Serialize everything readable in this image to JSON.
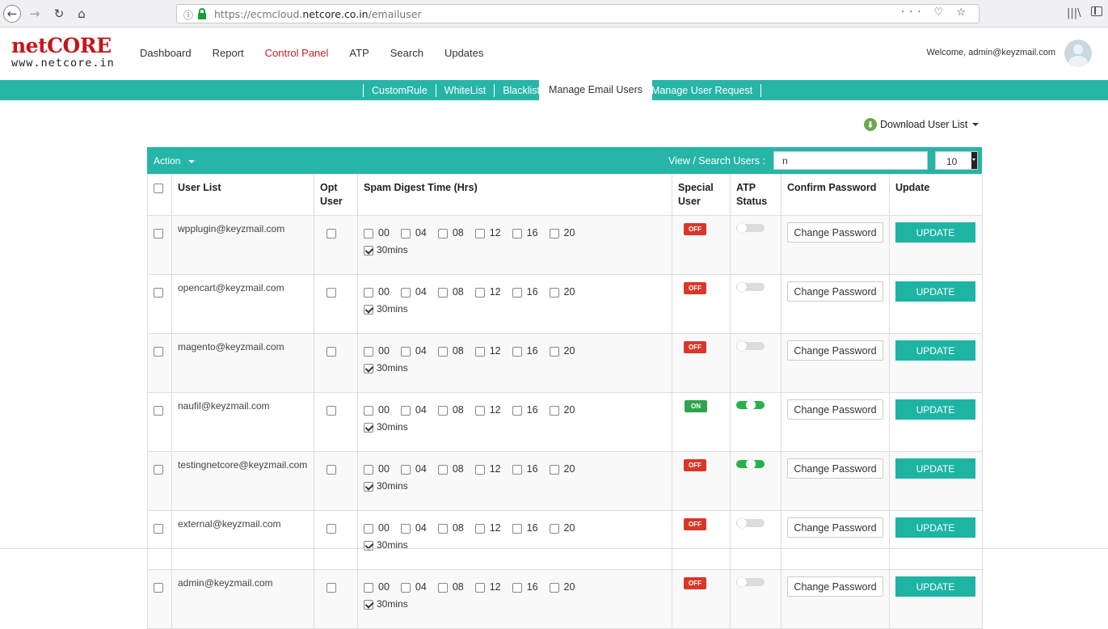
{
  "browser": {
    "url_prefix": "https://ecmcloud.",
    "url_domain": "netcore.co.in",
    "url_path": "/emailuser",
    "actions": "··· ♡ ☆"
  },
  "logo": {
    "top": "netC",
    "o": "O",
    "rest": "RE",
    "bottom": "www.netcore.in"
  },
  "nav": {
    "items": [
      "Dashboard",
      "Report",
      "Control Panel",
      "ATP",
      "Search",
      "Updates"
    ],
    "active": "Control Panel"
  },
  "welcome": "Welcome, admin@keyzmail.com",
  "subnav": [
    "CustomRule",
    "WhiteList",
    "Blacklist",
    "Manage Email Users",
    "Manage User Request"
  ],
  "download_label": "Download User List",
  "toolbar": {
    "action_label": "Action",
    "search_label": "View / Search Users :",
    "search_value": "n",
    "page_size": "10"
  },
  "columns": [
    "User List",
    "Opt User",
    "Spam Digest Time (Hrs)",
    "Special User",
    "ATP Status",
    "Confirm Password",
    "Update"
  ],
  "hours": [
    "00",
    "04",
    "08",
    "12",
    "16",
    "20"
  ],
  "minutes_label": "30mins",
  "change_password_label": "Change Password",
  "update_label": "UPDATE",
  "users": [
    {
      "email": "wpplugin@keyzmail.com",
      "special": "OFF",
      "atp_on": false
    },
    {
      "email": "opencart@keyzmail.com",
      "special": "OFF",
      "atp_on": false
    },
    {
      "email": "magento@keyzmail.com",
      "special": "OFF",
      "atp_on": false
    },
    {
      "email": "naufil@keyzmail.com",
      "special": "ON",
      "atp_on": true
    },
    {
      "email": "testingnetcore@keyzmail.com",
      "special": "OFF",
      "atp_on": true
    },
    {
      "email": "external@keyzmail.com",
      "special": "OFF",
      "atp_on": false
    },
    {
      "email": "admin@keyzmail.com",
      "special": "OFF",
      "atp_on": false
    }
  ],
  "colors": {
    "teal": "#26b5a7",
    "brand_red": "#c4151c",
    "off": "#d9372a",
    "on": "#2ea44f"
  }
}
